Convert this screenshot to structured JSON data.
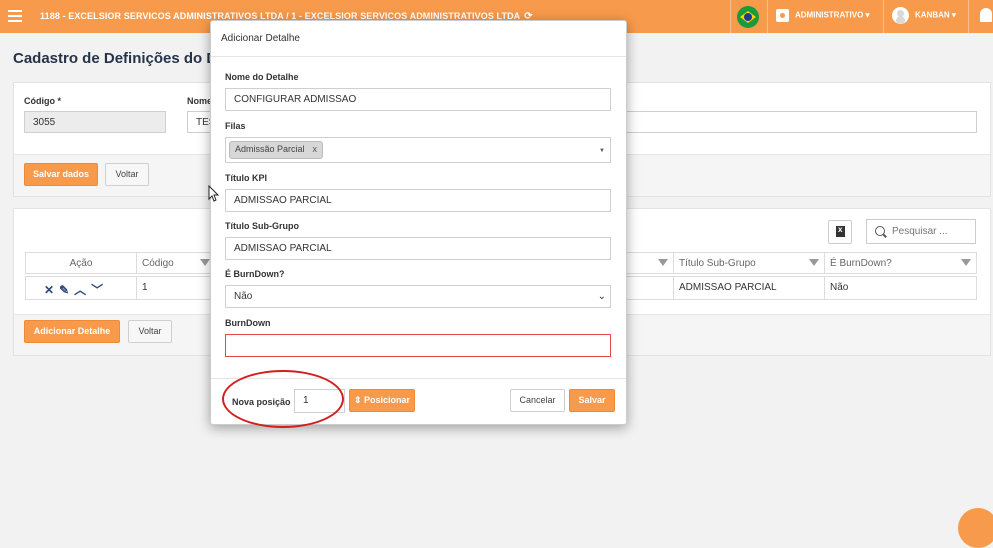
{
  "topbar": {
    "title": "1188 - EXCELSIOR SERVICOS ADMINISTRATIVOS LTDA / 1 - EXCELSIOR SERVICOS ADMINISTRATIVOS LTDA",
    "refresh_icon": "refresh-icon",
    "profile_menu": "ADMINISTRATIVO",
    "user_menu": "KANBAN",
    "accent_color": "#f79a4b"
  },
  "page": {
    "title": "Cadastro de Definições do Das",
    "codigo_label": "Código *",
    "codigo_value": "3055",
    "nome_label": "Nome",
    "nome_value": "TES",
    "save_button": "Salvar dados",
    "back_button": "Voltar"
  },
  "grid": {
    "search_placeholder": "Pesquisar ...",
    "columns": [
      "Ação",
      "Código",
      "Título Sub-Grupo",
      "É BurnDown?"
    ],
    "row": {
      "codigo": "1",
      "titulo_sub_grupo": "ADMISSAO PARCIAL",
      "burndown": "Não"
    },
    "add_button": "Adicionar Detalhe",
    "back_button": "Voltar"
  },
  "modal": {
    "title": "Adicionar Detalhe",
    "nome_detalhe_label": "Nome do Detalhe",
    "nome_detalhe_value": "CONFIGURAR ADMISSAO",
    "filas_label": "Filas",
    "filas_tag": "Admissão Parcial",
    "filas_tag_remove": "x",
    "titulo_kpi_label": "Título KPI",
    "titulo_kpi_value": "ADMISSAO PARCIAL",
    "titulo_sub_grupo_label": "Título Sub-Grupo",
    "titulo_sub_grupo_value": "ADMISSAO PARCIAL",
    "burndown_q_label": "É BurnDown?",
    "burndown_q_value": "Não",
    "burndown_label": "BurnDown",
    "burndown_value": "",
    "nova_posicao_label": "Nova posição",
    "nova_posicao_value": "1",
    "posicionar_button": "⇕ Posicionar",
    "cancel_button": "Cancelar",
    "save_button": "Salvar"
  }
}
